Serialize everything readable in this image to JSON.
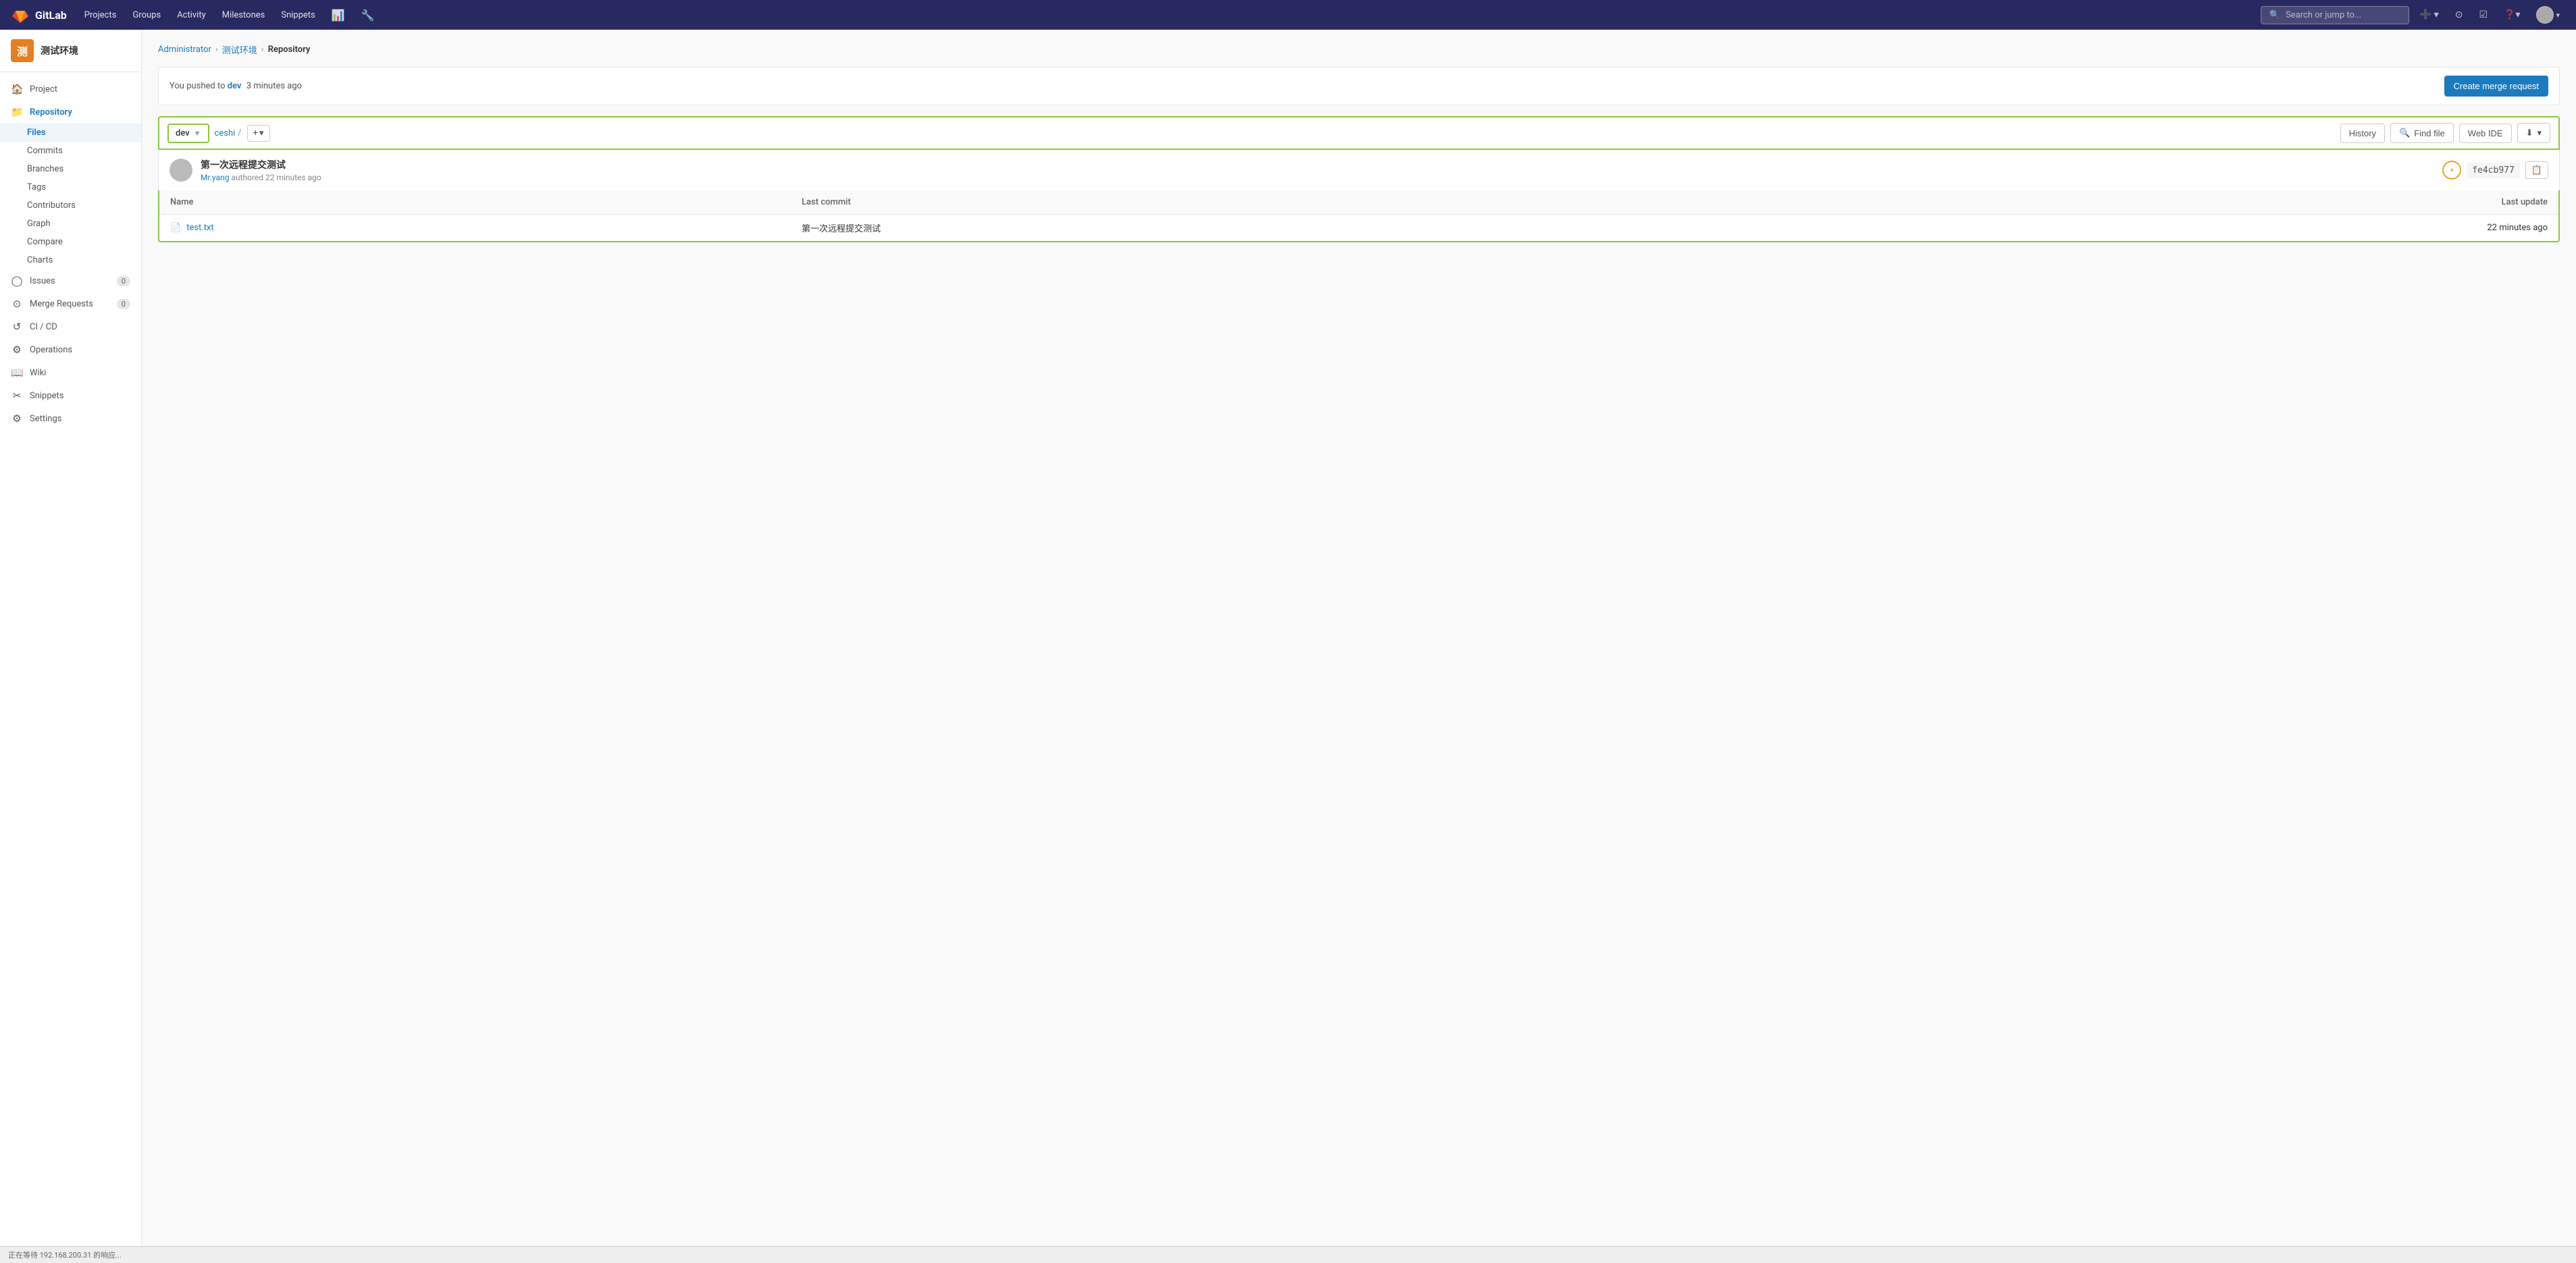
{
  "app": {
    "title": "GitLab",
    "logo_text": "GitLab"
  },
  "navbar": {
    "brand": "GitLab",
    "links": [
      {
        "label": "Projects",
        "has_dropdown": true
      },
      {
        "label": "Groups",
        "has_dropdown": true
      },
      {
        "label": "Activity"
      },
      {
        "label": "Milestones"
      },
      {
        "label": "Snippets"
      }
    ],
    "search_placeholder": "Search or jump to...",
    "icons": [
      "plus",
      "merge-request",
      "todo",
      "help",
      "user"
    ]
  },
  "sidebar": {
    "project_initial": "测",
    "project_name": "测试环境",
    "items": [
      {
        "id": "project",
        "label": "Project",
        "icon": "🏠"
      },
      {
        "id": "repository",
        "label": "Repository",
        "icon": "📁",
        "active": true,
        "expanded": true
      },
      {
        "id": "files",
        "label": "Files",
        "sub": true,
        "active": true
      },
      {
        "id": "commits",
        "label": "Commits",
        "sub": true
      },
      {
        "id": "branches",
        "label": "Branches",
        "sub": true
      },
      {
        "id": "tags",
        "label": "Tags",
        "sub": true
      },
      {
        "id": "contributors",
        "label": "Contributors",
        "sub": true
      },
      {
        "id": "graph",
        "label": "Graph",
        "sub": true
      },
      {
        "id": "compare",
        "label": "Compare",
        "sub": true
      },
      {
        "id": "charts",
        "label": "Charts",
        "sub": true
      },
      {
        "id": "issues",
        "label": "Issues",
        "icon": "◯",
        "badge": "0"
      },
      {
        "id": "merge-requests",
        "label": "Merge Requests",
        "icon": "⊙",
        "badge": "0"
      },
      {
        "id": "cicd",
        "label": "CI / CD",
        "icon": "↺"
      },
      {
        "id": "operations",
        "label": "Operations",
        "icon": "⚙"
      },
      {
        "id": "wiki",
        "label": "Wiki",
        "icon": "📖"
      },
      {
        "id": "snippets",
        "label": "Snippets",
        "icon": "✂"
      },
      {
        "id": "settings",
        "label": "Settings",
        "icon": "⚙"
      }
    ]
  },
  "breadcrumb": {
    "items": [
      "Administrator",
      "测试环境",
      "Repository"
    ]
  },
  "push_notification": {
    "text": "You pushed to",
    "branch": "dev",
    "time_ago": "3 minutes ago",
    "button_label": "Create merge request"
  },
  "repo_toolbar": {
    "branch": "dev",
    "path": "ceshi",
    "path_sep": "/",
    "history_label": "History",
    "find_file_label": "Find file",
    "web_ide_label": "Web IDE",
    "download_label": "Download"
  },
  "commit_info": {
    "message": "第一次远程提交测试",
    "author": "Mr.yang",
    "time_ago": "22 minutes ago",
    "verb": "authored",
    "hash": "fe4cb977"
  },
  "file_table": {
    "columns": {
      "name": "Name",
      "last_commit": "Last commit",
      "last_update": "Last update"
    },
    "rows": [
      {
        "name": "test.txt",
        "is_file": true,
        "last_commit": "第一次远程提交测试",
        "last_update": "22 minutes ago"
      }
    ]
  },
  "bottom_bar": {
    "text": "正在等待 192.168.200.31 的响应..."
  }
}
